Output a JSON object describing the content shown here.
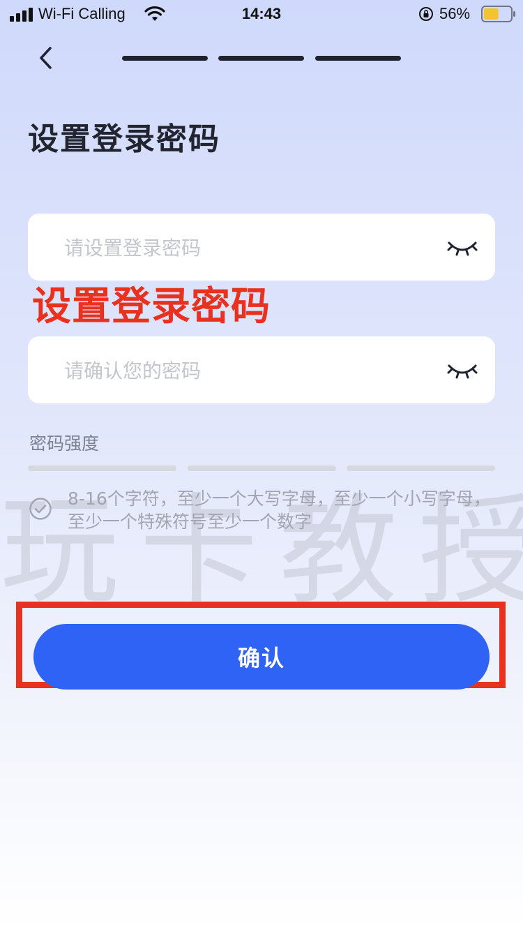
{
  "status_bar": {
    "carrier": "Wi-Fi Calling",
    "time": "14:43",
    "battery_percent": "56%",
    "battery_level": 0.56,
    "battery_color": "#f4c430"
  },
  "nav": {
    "back_icon": "chevron-left-icon",
    "progress_steps": 3
  },
  "page": {
    "title": "设置登录密码"
  },
  "form": {
    "password_placeholder": "请设置登录密码",
    "password_value": "",
    "confirm_placeholder": "请确认您的密码",
    "confirm_value": "",
    "eye_icon": "eye-closed-icon"
  },
  "annotation": {
    "caption": "设置登录密码",
    "color": "#e8321f"
  },
  "strength": {
    "label": "密码强度",
    "segments": 3,
    "level": 0
  },
  "rules": {
    "icon": "check-circle-icon",
    "text": "8-16个字符，至少一个大写字母，至少一个小写字母，至少一个特殊符号至少一个数字"
  },
  "watermark": {
    "text": "玩卡教授"
  },
  "actions": {
    "confirm_label": "确认",
    "accent_color": "#2f63f6"
  }
}
